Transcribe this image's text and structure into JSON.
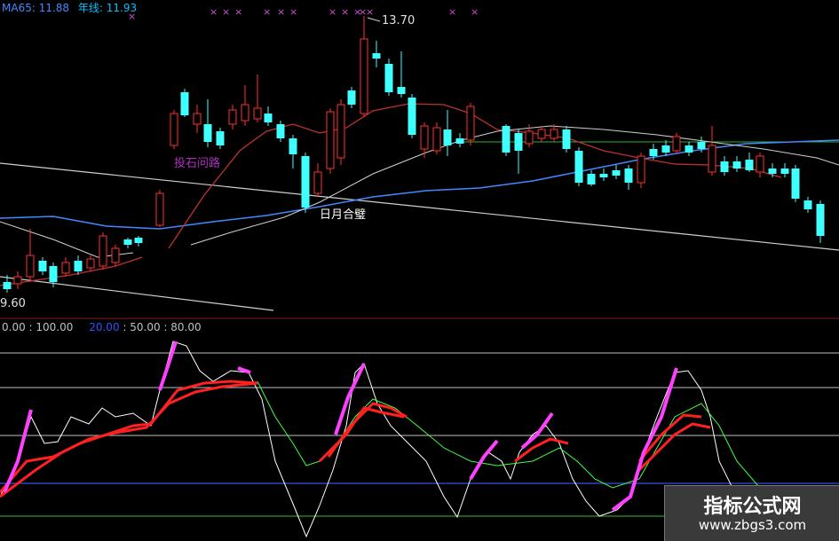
{
  "header": {
    "ma_label": "MA65: 11.88",
    "year_label": "年线: 11.93",
    "ma_color": "#4488ff",
    "year_color": "#00c0ff"
  },
  "price_panel": {
    "high_label": "13.70",
    "low_label": "9.60",
    "annotation_1": "投石问路",
    "annotation_2": "日月合璧",
    "annotation_1_color": "#b030c0",
    "annotation_2_color": "#ffffff",
    "marker_glyph": "×",
    "marker_color": "#d050d0",
    "up_color": "#ff3030",
    "down_color": "#40ffff"
  },
  "indicator_panel": {
    "params_a": "0.00 : 100.00",
    "params_b_key": "20.00",
    "params_b_rest": ": 50.00 : 80.00",
    "params_b_color": "#3050ff",
    "params_color": "#c0c0c0",
    "line_colors": {
      "fast": "#ffffff",
      "slow": "#40ff40",
      "main": "#ff2020",
      "highlight": "#ff40ff"
    }
  },
  "watermark": {
    "title": "指标公式网",
    "url": "www.zbgs3.com"
  },
  "chart_data": [
    {
      "type": "candlestick",
      "title": "",
      "ylim": [
        9.6,
        13.7
      ],
      "series": [
        {
          "name": "MA65",
          "color": "#4488ff"
        },
        {
          "name": "年线",
          "color": "#00c0ff"
        }
      ],
      "annotations": [
        "13.70",
        "9.60",
        "投石问路",
        "日月合璧"
      ],
      "grid": false
    },
    {
      "type": "line",
      "title": "",
      "ylim": [
        0,
        100
      ],
      "reference_levels": [
        0,
        20,
        50,
        80,
        100
      ]
    }
  ]
}
